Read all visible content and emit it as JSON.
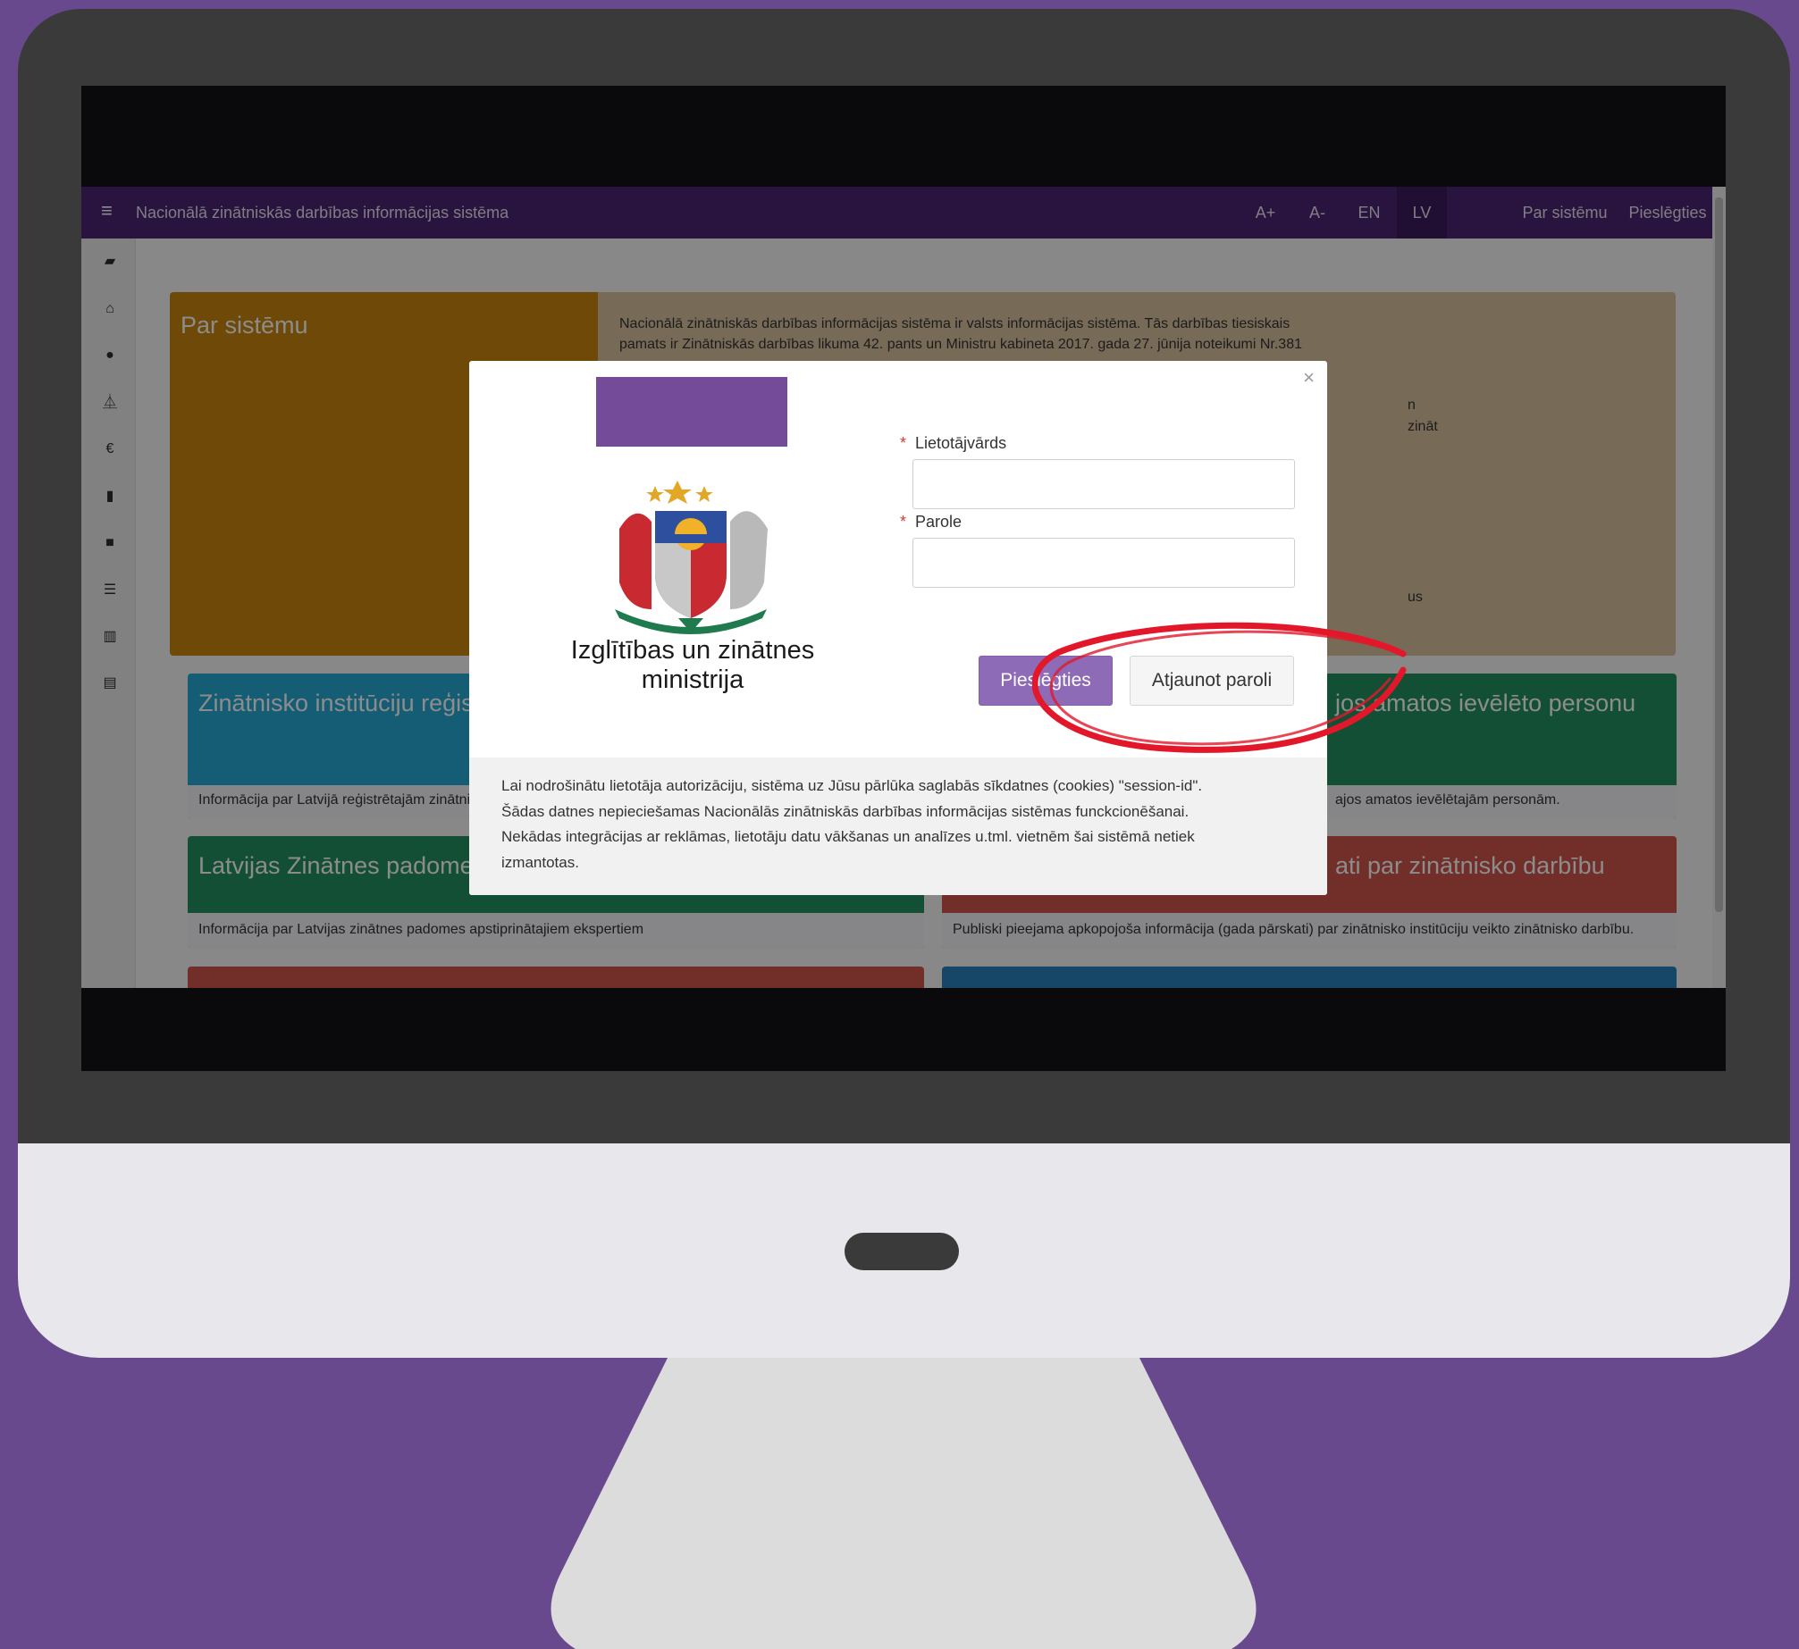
{
  "topbar": {
    "menu_icon": "hamburger-icon",
    "title": "Nacionālā zinātniskās darbības informācijas sistēma",
    "font_up": "A+",
    "font_down": "A-",
    "lang_en": "EN",
    "lang_lv": "LV",
    "about": "Par sistēmu",
    "login": "Pieslēgties"
  },
  "sidebar": {
    "icons": [
      "folder-open-icon",
      "institution-icon",
      "user-circle-icon",
      "flask-icon",
      "euro-icon",
      "book-icon",
      "folder-icon",
      "database-icon",
      "bar-chart-icon",
      "list-icon"
    ]
  },
  "about_card": {
    "title": "Par sistēmu",
    "text_line1": "Nacionālā zinātniskās darbības informācijas sistēma ir valsts informācijas sistēma. Tās darbības tiesiskais",
    "text_line2": "pamats ir Zinātniskās darbības likuma 42. pants un Ministru kabineta 2017. gada 27. jūnija noteikumi Nr.381",
    "frag1": "n",
    "frag2": "zināt",
    "frag3": "us"
  },
  "cards": {
    "institutions_title": "Zinātnisko institūciju reģistr",
    "institutions_text": "Informācija par Latvijā reģistrētajām zinātnis",
    "positions_title": "jos amatos ievēlēto personu",
    "positions_text": "ajos amatos ievēlētajām personām.",
    "council_title": "Latvijas Zinātnes padomes",
    "council_text": "Informācija par Latvijas zinātnes padomes apstiprinātajiem ekspertiem",
    "reports_title": "ati par zinātnisko darbību",
    "reports_text": "Publiski pieejama apkopojoša informācija (gada pārskati) par zinātnisko institūciju veikto zinātnisko darbību."
  },
  "modal": {
    "close": "×",
    "ministry_line1": "Izglītības un zinātnes",
    "ministry_line2": "ministrija",
    "required_mark": "*",
    "username_label": "Lietotājvārds",
    "username_value": "",
    "password_label": "Parole",
    "password_value": "",
    "login_button": "Pieslēgties",
    "reset_button": "Atjaunot paroli",
    "cookie_line1": "Lai nodrošinātu lietotāja autorizāciju, sistēma uz Jūsu pārlūka saglabās sīkdatnes (cookies) \"session-id\".",
    "cookie_line2": "Šādas datnes nepieciešamas Nacionālās zinātniskās darbības informācijas sistēmas funckcionēšanai.",
    "cookie_line3": "Nekādas integrācijas ar reklāmas, lietotāju datu vākšanas un analīzes u.tml. vietnēm šai sistēmā netiek",
    "cookie_line4": "izmantotas."
  },
  "colors": {
    "background": "#69498e",
    "topbar": "#4a2572",
    "accent_button": "#8e6bb6",
    "card_orange": "#c8860e",
    "card_tan": "#d9c3a0",
    "card_cyan": "#27a9d4",
    "card_green": "#239062",
    "card_red": "#d0544a",
    "card_blue": "#2a82bd",
    "annotation_red": "#e2182a"
  }
}
